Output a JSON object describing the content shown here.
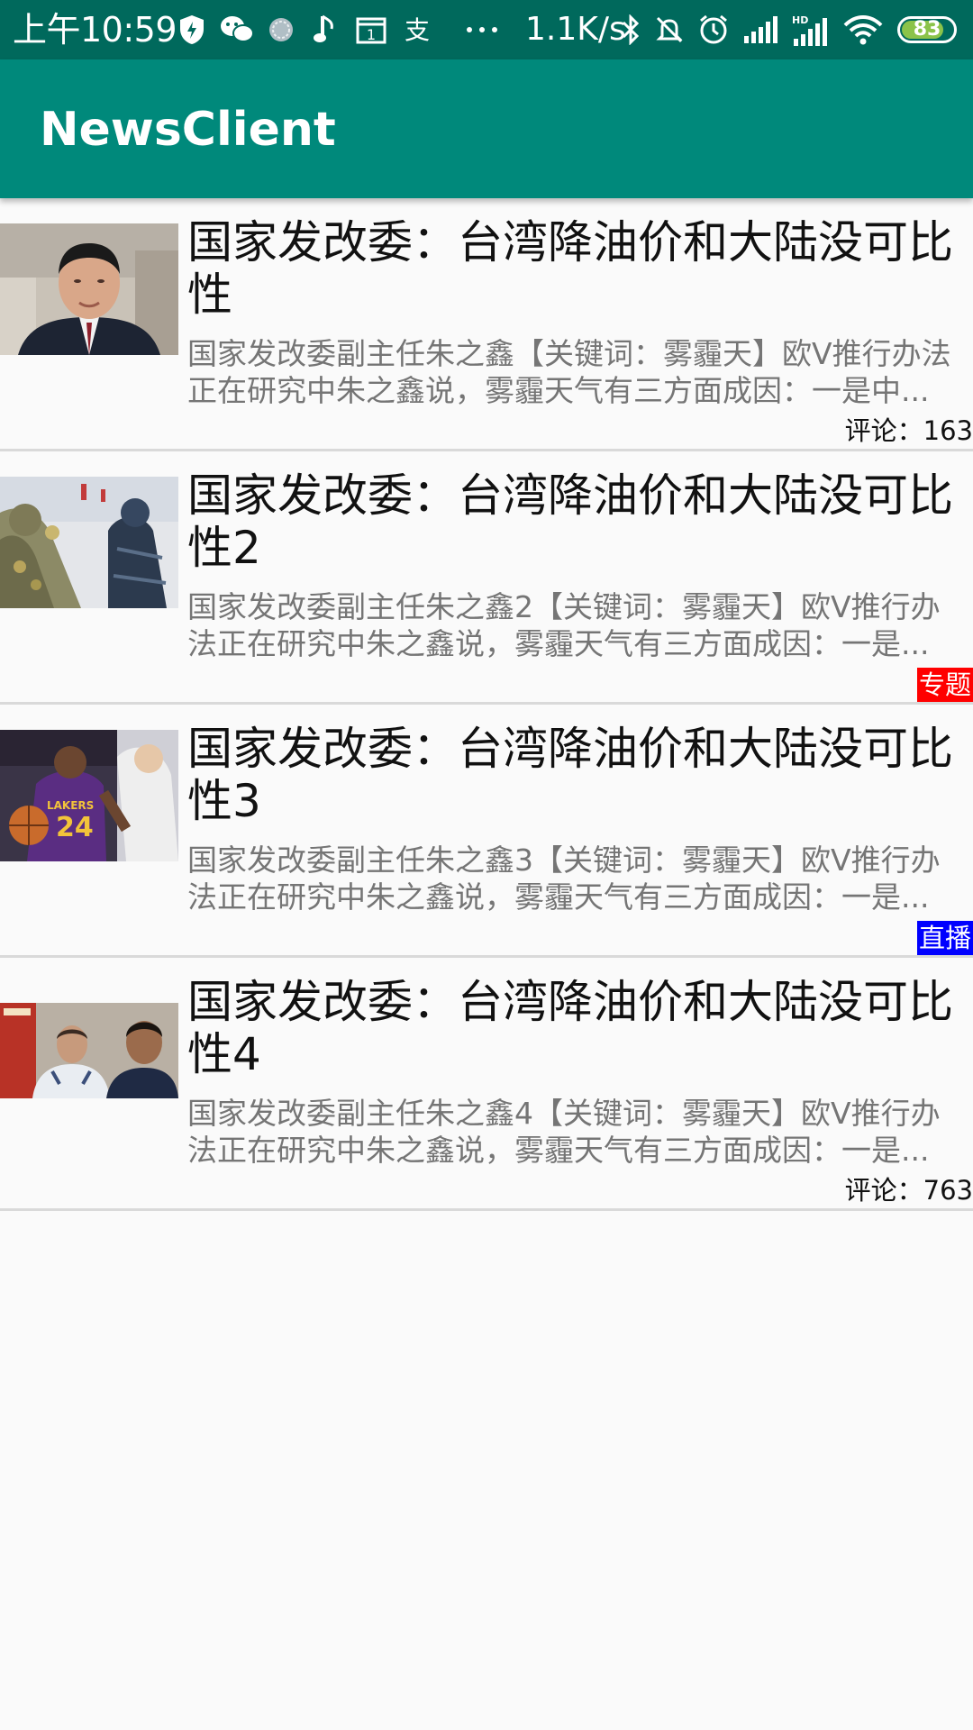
{
  "status_bar": {
    "time": "上午10:59",
    "network_speed": "1.1K/s",
    "battery_level": "83",
    "battery_fraction": 0.83,
    "icons": [
      "shield-icon",
      "wechat-icon",
      "sync-icon",
      "music-note-icon",
      "calendar-icon",
      "alipay-icon",
      "more-dots-icon",
      "bluetooth-icon",
      "mute-bell-icon",
      "alarm-icon",
      "signal-icon",
      "hd-signal-icon",
      "wifi-icon",
      "battery-icon"
    ]
  },
  "app_bar": {
    "title": "NewsClient",
    "color": "#00897b",
    "status_color": "#00695c"
  },
  "news": [
    {
      "title": "国家发改委：台湾降油价和大陆没可比性",
      "summary": "国家发改委副主任朱之鑫【关键词：雾霾天】欧V推行办法正在研究中朱之鑫说，雾霾天气有三方面成因：一是中...",
      "footer_type": "comment",
      "footer_text": "评论：163",
      "image": "portrait-photo"
    },
    {
      "title": "国家发改委：台湾降油价和大陆没可比性2",
      "summary": "国家发改委副主任朱之鑫2【关键词：雾霾天】欧V推行办法正在研究中朱之鑫说，雾霾天气有三方面成因：一是...",
      "footer_type": "tag",
      "footer_text": "专题",
      "tag_color": "#ff0000",
      "image": "soldiers-photo"
    },
    {
      "title": "国家发改委：台湾降油价和大陆没可比性3",
      "summary": "国家发改委副主任朱之鑫3【关键词：雾霾天】欧V推行办法正在研究中朱之鑫说，雾霾天气有三方面成因：一是...",
      "footer_type": "tag",
      "footer_text": "直播",
      "tag_color": "#0000ff",
      "image": "basketball-photo"
    },
    {
      "title": "国家发改委：台湾降油价和大陆没可比性4",
      "summary": "国家发改委副主任朱之鑫4【关键词：雾霾天】欧V推行办法正在研究中朱之鑫说，雾霾天气有三方面成因：一是...",
      "footer_type": "comment",
      "footer_text": "评论：763",
      "image": "two-men-photo"
    }
  ]
}
